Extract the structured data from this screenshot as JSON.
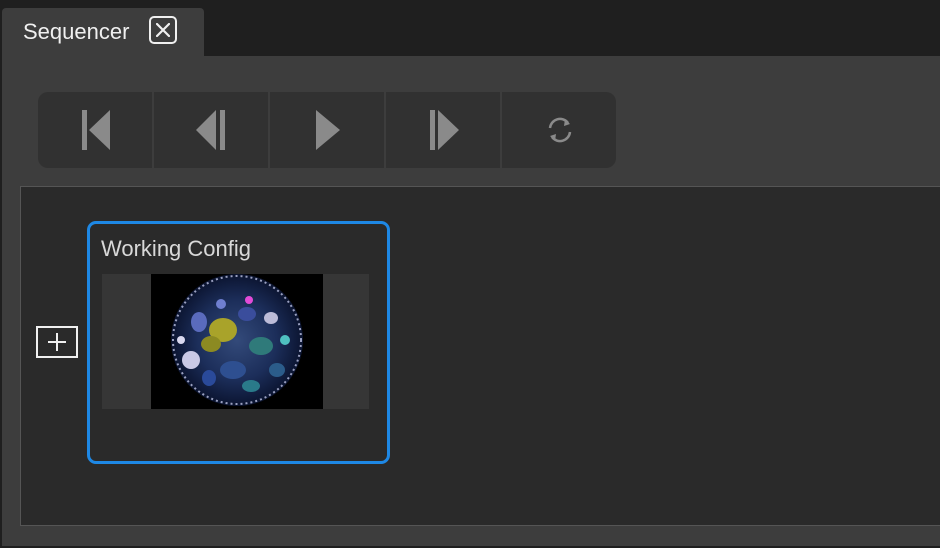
{
  "tab": {
    "title": "Sequencer",
    "close_icon": "close-icon"
  },
  "toolbar": {
    "buttons": [
      {
        "name": "skip-to-start-button",
        "icon": "skip-to-start-icon"
      },
      {
        "name": "step-back-button",
        "icon": "step-back-icon"
      },
      {
        "name": "play-button",
        "icon": "play-icon"
      },
      {
        "name": "step-forward-button",
        "icon": "step-forward-icon"
      },
      {
        "name": "loop-button",
        "icon": "loop-icon"
      }
    ]
  },
  "sequence": {
    "add_icon": "plus-box-icon",
    "cards": [
      {
        "title": "Working Config",
        "selected": true,
        "accent": "#1e88e5"
      }
    ]
  },
  "colors": {
    "background": "#1f1f1f",
    "panel": "#3d3d3d",
    "stage": "#2a2a2a",
    "accent": "#1e88e5",
    "icon": "#8a8a8a"
  }
}
